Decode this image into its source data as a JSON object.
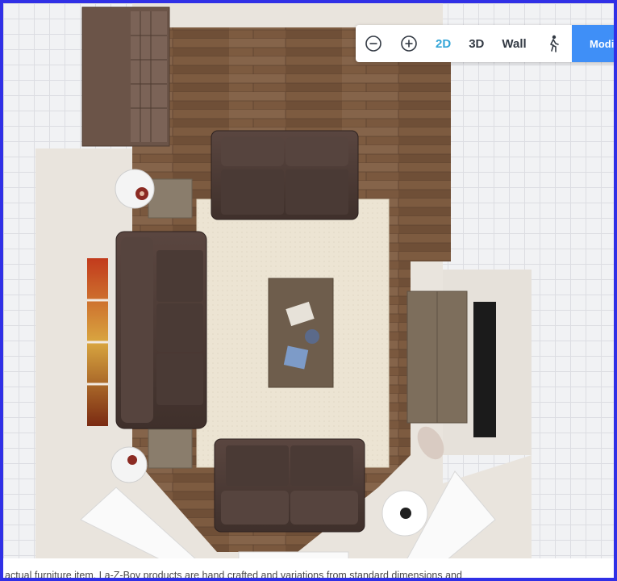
{
  "toolbar": {
    "zoom_out_icon": "zoom-out-icon",
    "zoom_in_icon": "zoom-in-icon",
    "view_2d_label": "2D",
    "view_3d_label": "3D",
    "wall_label": "Wall",
    "walk_icon": "walk-icon",
    "modify_label": "Modif",
    "active_view": "2D"
  },
  "colors": {
    "accent": "#34a6d8",
    "modify_button": "#3f8ff7",
    "frame_border": "#3030e6"
  },
  "footer": {
    "disclaimer_text": "actual furniture item. La-Z-Boy products are hand crafted and variations from standard dimensions and"
  }
}
